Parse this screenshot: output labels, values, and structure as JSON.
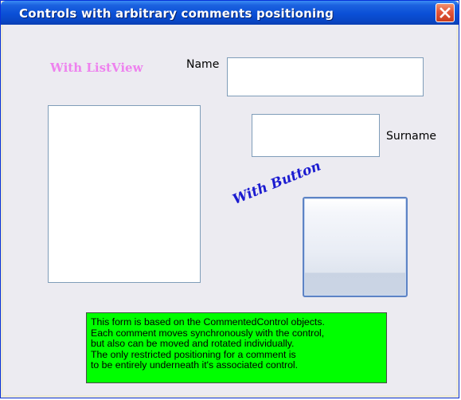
{
  "window": {
    "title": "Controls with arbitrary comments positioning",
    "close_icon": "close-icon",
    "close_color": "#d9482c",
    "title_color": "#0a4fd6"
  },
  "form": {
    "name_label": "Name",
    "name_value": "",
    "surname_label": "Surname",
    "surname_value": "",
    "listview_comment": "With ListView",
    "listview_comment_color": "#ee82ee",
    "button_comment": "With Button",
    "button_comment_color": "#1b1bd0",
    "info_lines": [
      "This form is based on the CommentedControl objects.",
      "Each comment moves synchronously with the control,",
      "but also can be moved and rotated individually.",
      "The only restricted positioning for a comment is",
      "to be entirely underneath it's associated control."
    ],
    "info_background": "#00ff00"
  }
}
